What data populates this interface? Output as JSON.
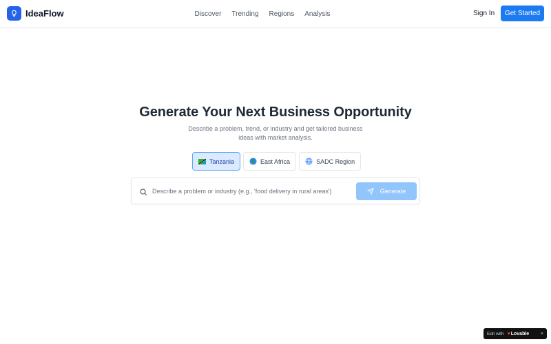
{
  "header": {
    "brand": "IdeaFlow",
    "nav": [
      "Discover",
      "Trending",
      "Regions",
      "Analysis"
    ],
    "sign_in": "Sign In",
    "get_started": "Get Started",
    "accent_color": "#1d7bf2"
  },
  "hero": {
    "title": "Generate Your Next Business Opportunity",
    "subtitle": "Describe a problem, trend, or industry and get tailored business ideas with market analysis."
  },
  "regions": [
    {
      "label": "Tanzania",
      "icon": "tanzania-flag-icon",
      "active": true
    },
    {
      "label": "East Africa",
      "icon": "globe-africa-icon",
      "active": false
    },
    {
      "label": "SADC Region",
      "icon": "globe-icon",
      "active": false
    }
  ],
  "search": {
    "value": "",
    "placeholder": "Describe a problem or industry (e.g., 'food delivery in rural areas')",
    "button": "Generate"
  },
  "badge": {
    "edit_with": "Edit with",
    "brand": "Lovable",
    "close": "×"
  }
}
